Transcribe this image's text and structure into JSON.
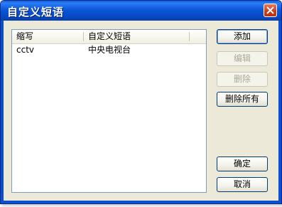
{
  "window": {
    "title": "自定义短语"
  },
  "list": {
    "columns": [
      "缩写",
      "自定义短语"
    ],
    "rows": [
      {
        "abbr": "cctv",
        "phrase": "中央电视台"
      }
    ]
  },
  "buttons": {
    "add": "添加",
    "edit": "编辑",
    "delete": "删除",
    "delete_all": "删除所有",
    "ok": "确定",
    "cancel": "取消"
  }
}
